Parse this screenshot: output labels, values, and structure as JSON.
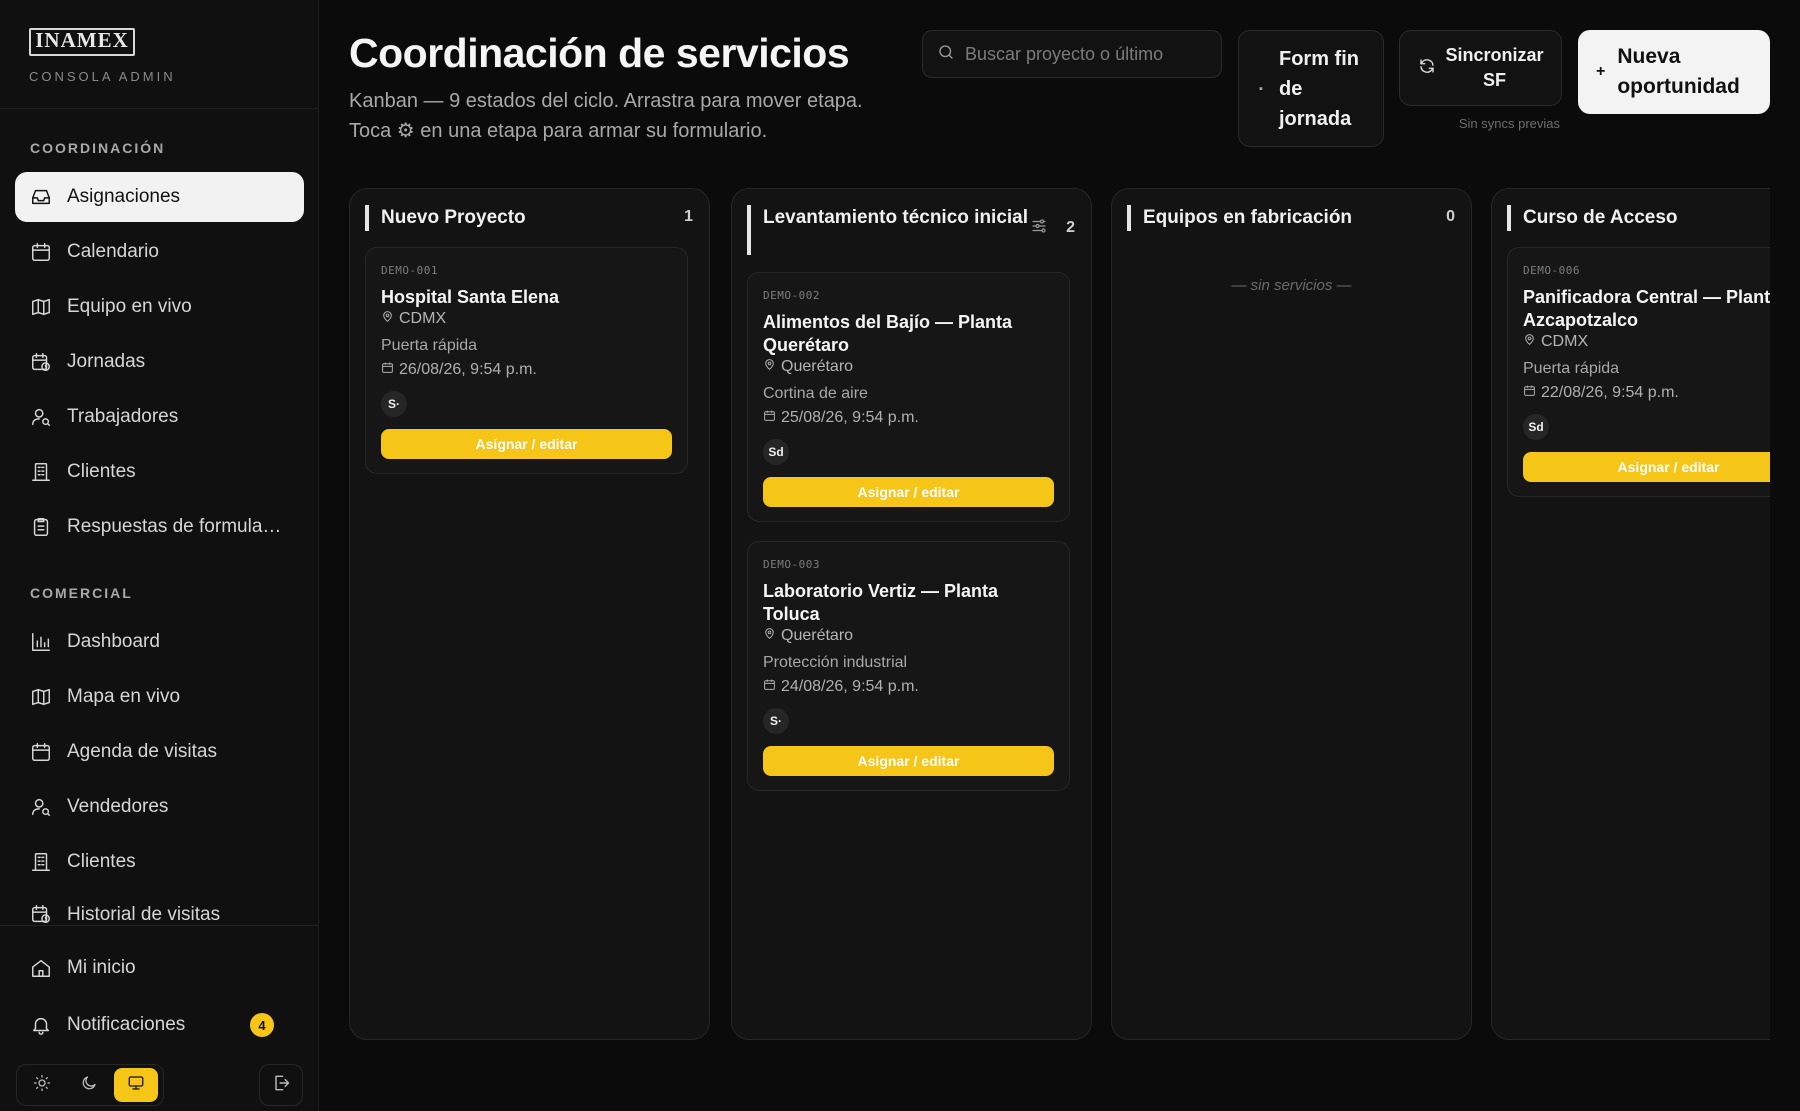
{
  "brand": {
    "logo": "INAMEX",
    "subtitle": "CONSOLA ADMIN"
  },
  "sidebar": {
    "sections": [
      {
        "label": "COORDINACIÓN"
      },
      {
        "label": "COMERCIAL"
      }
    ],
    "coordinacion": [
      {
        "label": "Asignaciones",
        "icon": "inbox-icon",
        "active": true
      },
      {
        "label": "Calendario",
        "icon": "calendar-icon"
      },
      {
        "label": "Equipo en vivo",
        "icon": "map-icon"
      },
      {
        "label": "Jornadas",
        "icon": "calendar-clock-icon"
      },
      {
        "label": "Trabajadores",
        "icon": "user-search-icon"
      },
      {
        "label": "Clientes",
        "icon": "building-icon"
      },
      {
        "label": "Respuestas de formularios",
        "icon": "clipboard-icon"
      }
    ],
    "comercial": [
      {
        "label": "Dashboard",
        "icon": "bar-chart-icon"
      },
      {
        "label": "Mapa en vivo",
        "icon": "map-icon"
      },
      {
        "label": "Agenda de visitas",
        "icon": "calendar-icon"
      },
      {
        "label": "Vendedores",
        "icon": "user-search-icon"
      },
      {
        "label": "Clientes",
        "icon": "building-icon"
      },
      {
        "label": "Historial de visitas",
        "icon": "calendar-clock-icon"
      }
    ],
    "bottom": [
      {
        "label": "Mi inicio",
        "icon": "home-icon"
      },
      {
        "label": "Notificaciones",
        "icon": "bell-icon",
        "badge": "4"
      }
    ],
    "theme": {
      "options": [
        "light",
        "dark",
        "system"
      ],
      "selected": "system"
    }
  },
  "header": {
    "title": "Coordinación de servicios",
    "subtitle": "Kanban — 9 estados del ciclo. Arrastra para mover etapa. Toca ⚙ en una etapa para armar su formulario.",
    "search_placeholder": "Buscar proyecto o último",
    "form_button": "Form fin de jornada",
    "sync_button": "Sincronizar SF",
    "sync_note": "Sin syncs previas",
    "new_button": "Nueva oportunidad"
  },
  "board": {
    "columns": [
      {
        "title": "Nuevo Proyecto",
        "count": "1",
        "has_config": false,
        "cards": [
          {
            "code": "DEMO-001",
            "title": "Hospital Santa Elena",
            "location": "CDMX",
            "type": "Puerta rápida",
            "date": "26/08/26, 9:54 p.m.",
            "avatar": "S·",
            "action": "Asignar / editar"
          }
        ]
      },
      {
        "title": "Levantamiento técnico inicial",
        "count": "2",
        "has_config": true,
        "cards": [
          {
            "code": "DEMO-002",
            "title": "Alimentos del Bajío — Planta Querétaro",
            "location": "Querétaro",
            "type": "Cortina de aire",
            "date": "25/08/26, 9:54 p.m.",
            "avatar": "Sd",
            "action": "Asignar / editar"
          },
          {
            "code": "DEMO-003",
            "title": "Laboratorio Vertiz — Planta Toluca",
            "location": "Querétaro",
            "type": "Protección industrial",
            "date": "24/08/26, 9:54 p.m.",
            "avatar": "S·",
            "action": "Asignar / editar"
          }
        ]
      },
      {
        "title": "Equipos en fabricación",
        "count": "0",
        "has_config": false,
        "empty_text": "— sin servicios —",
        "cards": []
      },
      {
        "title": "Curso de Acceso",
        "count": "",
        "has_config": false,
        "cards": [
          {
            "code": "DEMO-006",
            "title": "Panificadora Central — Planta Azcapotzalco",
            "location": "CDMX",
            "type": "Puerta rápida",
            "date": "22/08/26, 9:54 p.m.",
            "avatar": "Sd",
            "action": "Asignar / editar"
          }
        ]
      }
    ]
  },
  "colors": {
    "accent": "#f5c518",
    "background": "#0b0b0b",
    "panel": "#131313"
  }
}
